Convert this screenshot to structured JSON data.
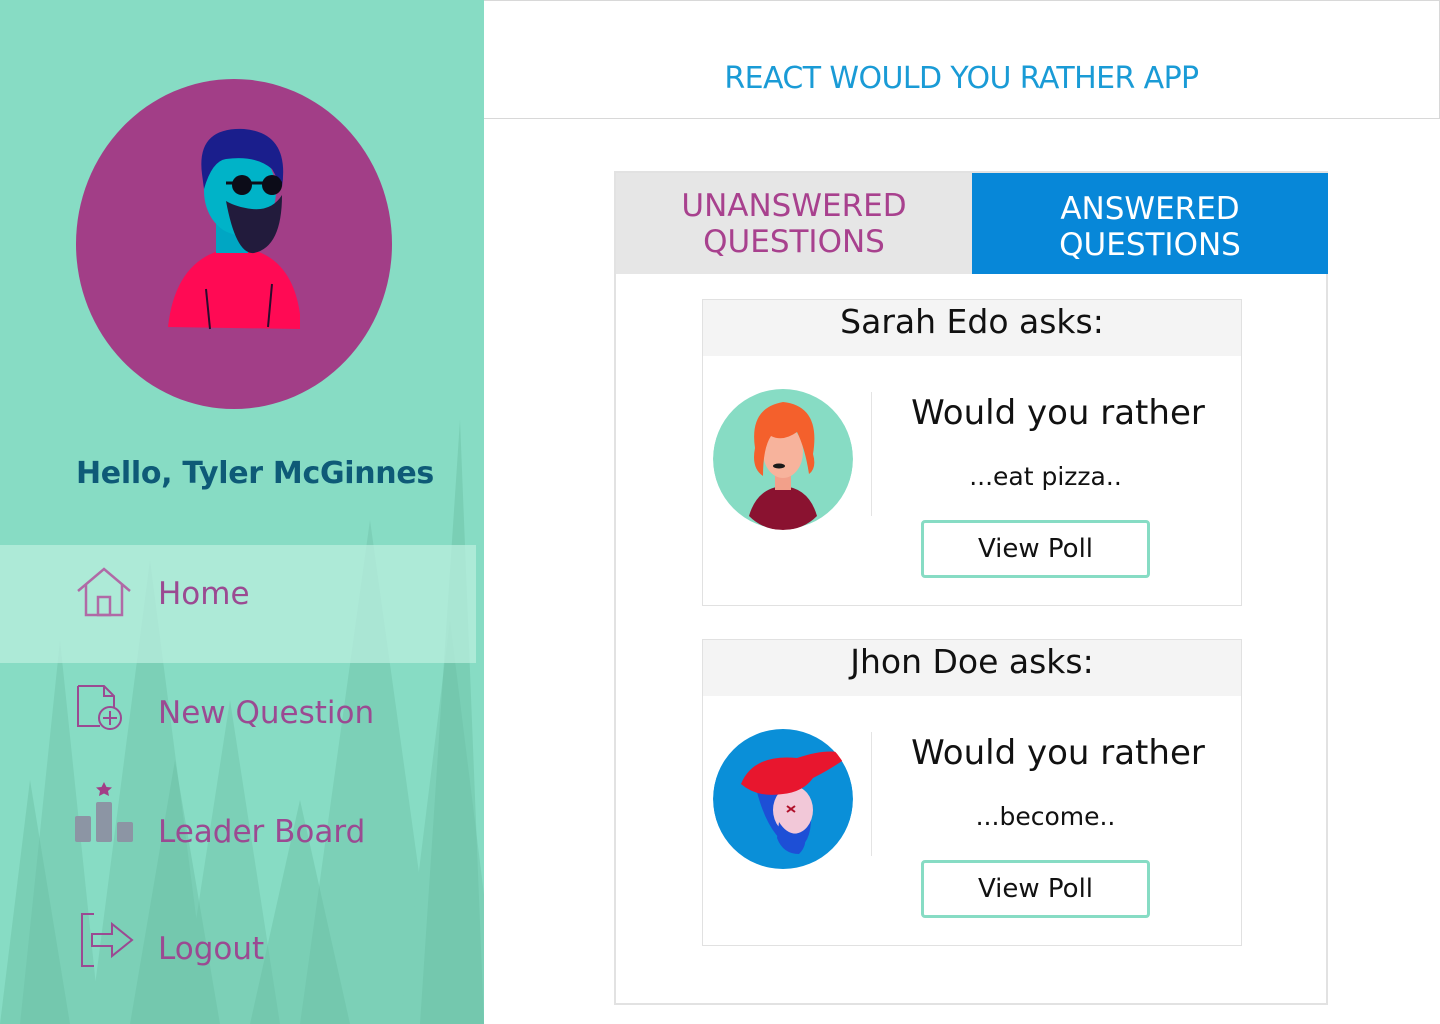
{
  "app": {
    "title": "REACT WOULD YOU RATHER APP"
  },
  "sidebar": {
    "greeting": "Hello, Tyler McGinnes",
    "items": [
      {
        "label": "Home",
        "icon": "home-icon",
        "active": true
      },
      {
        "label": "New Question",
        "icon": "new-document-icon",
        "active": false
      },
      {
        "label": "Leader Board",
        "icon": "leaderboard-icon",
        "active": false
      },
      {
        "label": "Logout",
        "icon": "logout-icon",
        "active": false
      }
    ]
  },
  "tabs": [
    {
      "line1": "UNANSWERED",
      "line2": "QUESTIONS",
      "selected": false
    },
    {
      "line1": "ANSWERED",
      "line2": "QUESTIONS",
      "selected": true
    }
  ],
  "questions": [
    {
      "author": "Sarah Edo asks:",
      "prompt": "Would you rather",
      "option": "...eat pizza..",
      "button": "View Poll",
      "avatar": "red-haired-woman-avatar"
    },
    {
      "author": "Jhon Doe asks:",
      "prompt": "Would you rather",
      "option": "...become..",
      "button": "View Poll",
      "avatar": "red-cap-man-avatar"
    }
  ],
  "colors": {
    "sidebar_bg": "#87dcc4",
    "accent_purple": "#a23e87",
    "accent_blue": "#0787d8",
    "title_blue": "#1a9bd6",
    "greeting": "#0e5a77",
    "nav_text": "#9b4a92",
    "button_border": "#87dcc4"
  }
}
